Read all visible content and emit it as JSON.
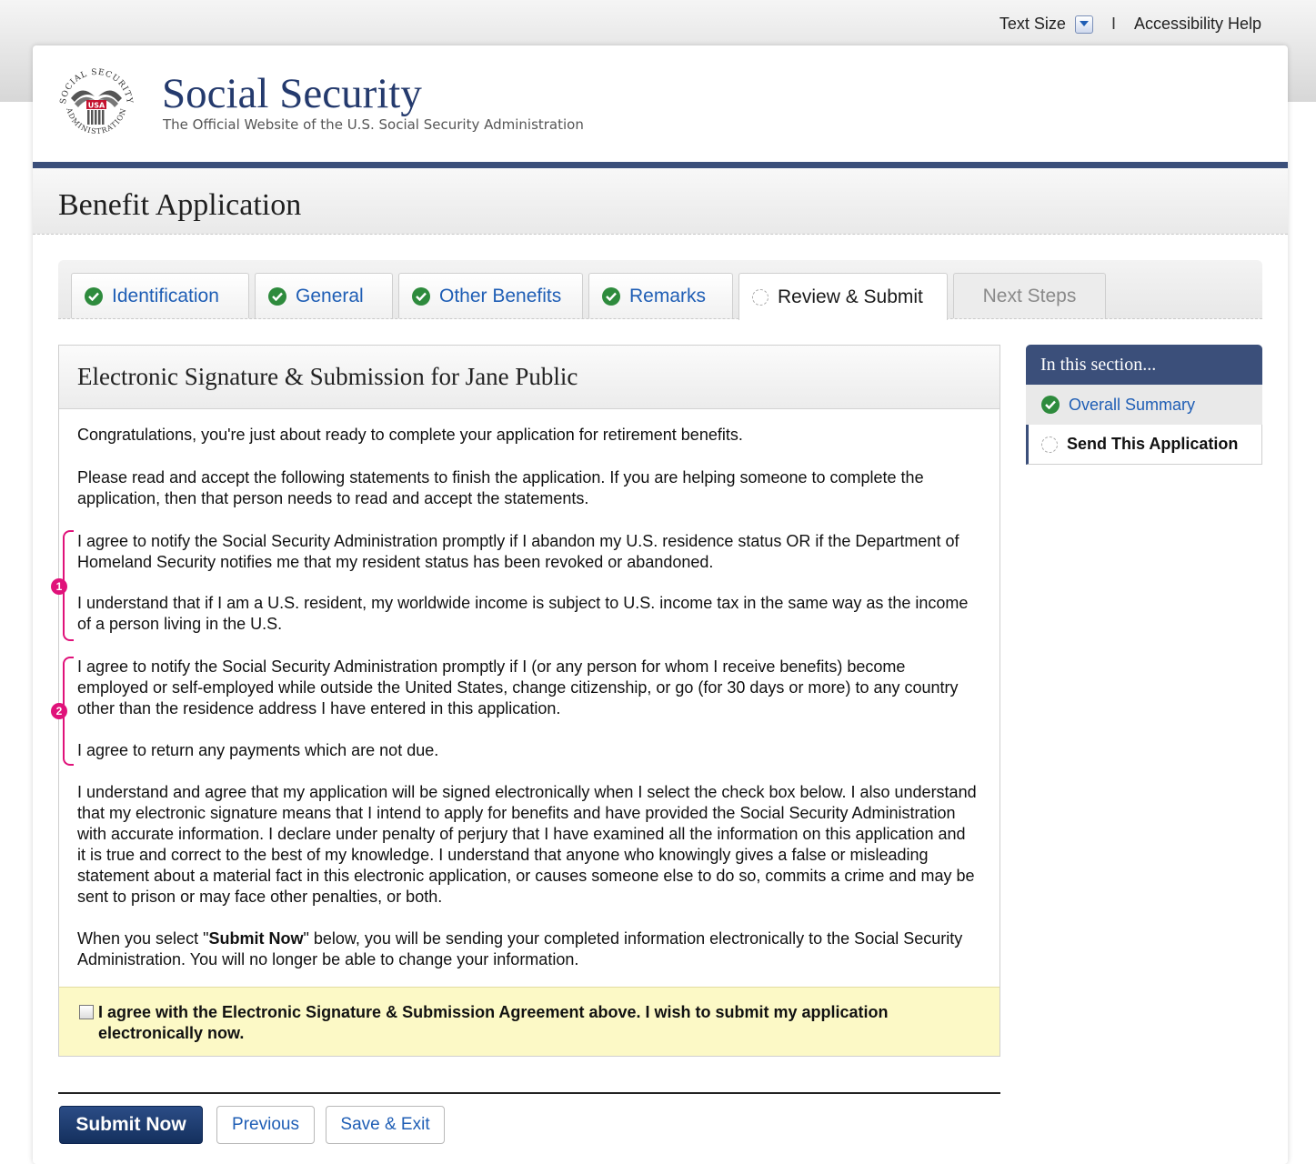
{
  "utility": {
    "text_size_label": "Text Size",
    "separator": "I",
    "accessibility_help": "Accessibility Help"
  },
  "header": {
    "site_title": "Social Security",
    "site_subtitle": "The Official Website of the U.S. Social Security Administration",
    "seal_text_top": "SOCIAL SECURITY",
    "seal_text_bottom": "ADMINISTRATION",
    "seal_shield": "USA"
  },
  "page_title": "Benefit Application",
  "tabs": [
    {
      "label": "Identification",
      "status": "complete"
    },
    {
      "label": "General",
      "status": "complete"
    },
    {
      "label": "Other Benefits",
      "status": "complete"
    },
    {
      "label": "Remarks",
      "status": "complete"
    },
    {
      "label": "Review & Submit",
      "status": "current"
    },
    {
      "label": "Next Steps",
      "status": "disabled"
    }
  ],
  "panel": {
    "title": "Electronic Signature & Submission for Jane Public",
    "intro": "Congratulations, you're just about ready to complete your application for retirement benefits.",
    "instructions": "Please read and accept the following statements to finish the application. If you are helping someone to complete the application, then that person needs to read and accept the statements.",
    "group1": {
      "marker": "1",
      "statement_a": "I agree to notify the Social Security Administration promptly if I abandon my U.S. residence status OR if the Department of Homeland Security notifies me that my resident status has been revoked or abandoned.",
      "statement_b": "I understand that if I am a U.S. resident, my worldwide income is subject to U.S. income tax in the same way as the income of a person living in the U.S."
    },
    "group2": {
      "marker": "2",
      "statement_a": "I agree to notify the Social Security Administration promptly if I (or any person for whom I receive benefits) become employed or self-employed while outside the United States, change citizenship, or go (for 30 days or more) to any country other than the residence address I have entered in this application.",
      "statement_b": "I agree to return any payments which are not due."
    },
    "declaration": "I understand and agree that my application will be signed electronically when I select the check box below. I also understand that my electronic signature means that I intend to apply for benefits and have provided the Social Security Administration with accurate information. I declare under penalty of perjury that I have examined all the information on this application and it is true and correct to the best of my knowledge. I understand that anyone who knowingly gives a false or misleading statement about a material fact in this electronic application, or causes someone else to do so, commits a crime and may be sent to prison or may face other penalties, or both.",
    "submit_note_prefix": "When you select \"",
    "submit_note_bold": "Submit Now",
    "submit_note_suffix": "\" below, you will be sending your completed information electronically to the Social Security Administration. You will no longer be able to change your information.",
    "agreement_checkbox_label": "I agree with the Electronic Signature & Submission Agreement above. I wish to submit my application electronically now.",
    "agreement_checked": false
  },
  "sidebar": {
    "heading": "In this section...",
    "items": [
      {
        "label": "Overall Summary",
        "status": "complete"
      },
      {
        "label": "Send This Application",
        "status": "current"
      }
    ]
  },
  "buttons": {
    "submit": "Submit Now",
    "previous": "Previous",
    "save_exit": "Save & Exit"
  },
  "colors": {
    "brand_navy": "#3b4f7a",
    "link_blue": "#1f5eb5",
    "check_green": "#2e8b3d",
    "annotation_pink": "#e0127a",
    "agree_yellow": "#fcf9c6"
  }
}
